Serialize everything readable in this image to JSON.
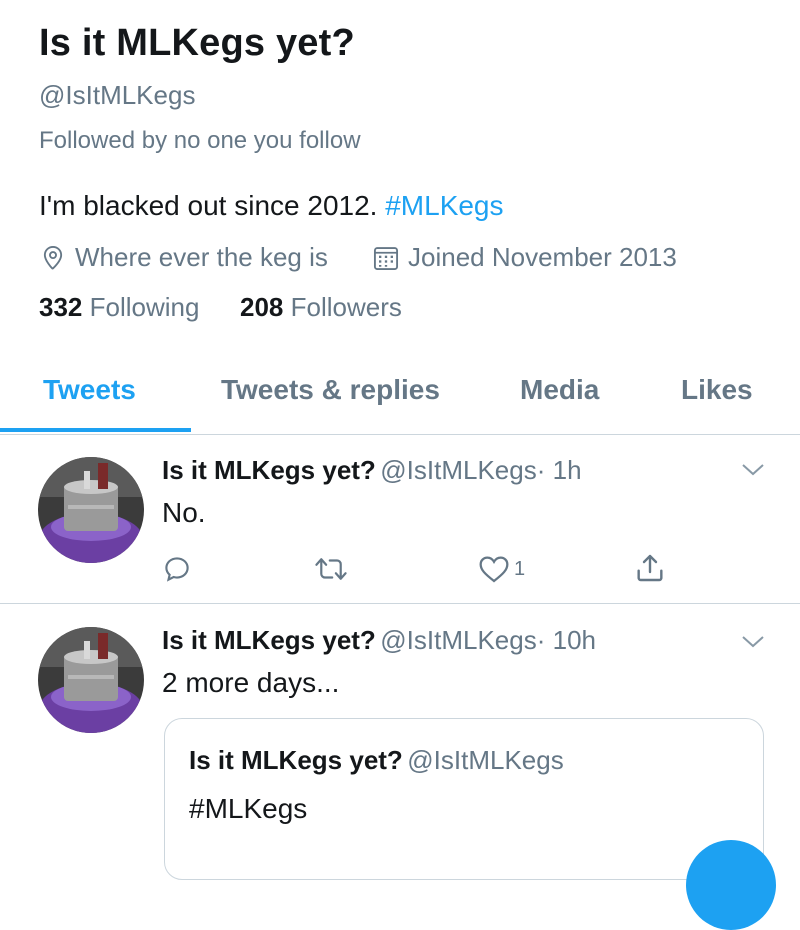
{
  "profile": {
    "name": "Is it MLKegs yet?",
    "handle": "@IsItMLKegs",
    "followed_by": "Followed by no one you follow",
    "bio_text": "I'm blacked out since 2012. ",
    "bio_hashtag": "#MLKegs",
    "location": "Where ever the keg is",
    "joined": "Joined November 2013",
    "following_count": "332",
    "following_label": "Following",
    "followers_count": "208",
    "followers_label": "Followers"
  },
  "tabs": [
    {
      "label": "Tweets",
      "active": true
    },
    {
      "label": "Tweets & replies"
    },
    {
      "label": "Media"
    },
    {
      "label": "Likes"
    }
  ],
  "tweets": [
    {
      "name": "Is it MLKegs yet?",
      "handle": "@IsItMLKegs",
      "time": "· 1h",
      "text": "No.",
      "like_count": "1"
    },
    {
      "name": "Is it MLKegs yet?",
      "handle": "@IsItMLKegs",
      "time": "· 10h",
      "text": "2 more days...",
      "quote": {
        "name": "Is it MLKegs yet?",
        "handle": "@IsItMLKegs",
        "text": "#MLKegs"
      }
    }
  ],
  "colors": {
    "accent": "#1da1f2",
    "secondary_text": "#657786",
    "primary_text": "#14171a",
    "divider": "#ccd6dd"
  },
  "icons": [
    "location-pin-icon",
    "calendar-icon",
    "reply-icon",
    "retweet-icon",
    "heart-icon",
    "share-icon",
    "chevron-down-icon"
  ]
}
